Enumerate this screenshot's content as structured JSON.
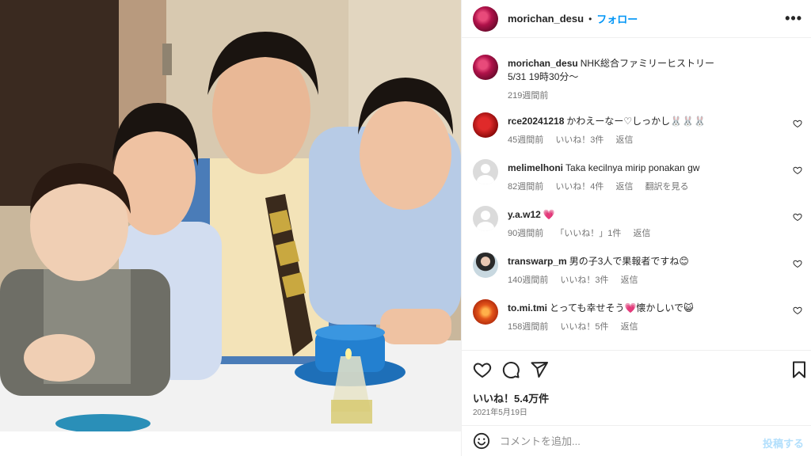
{
  "post": {
    "author": "morichan_desu",
    "follow_label": "フォロー",
    "separator": "•",
    "more_icon": "more-horizontal-icon",
    "photo_alt": "Family photo"
  },
  "caption": {
    "user": "morichan_desu",
    "text_line1": "NHK総合ファミリーヒストリー",
    "text_line2": "5/31 19時30分〜",
    "time": "219週間前"
  },
  "comments": [
    {
      "user": "rce20241218",
      "text": "かわえーなー♡しっかし🐰🐰🐰",
      "time": "45週間前",
      "likes": "いいね！3件",
      "reply": "返信",
      "translate": ""
    },
    {
      "user": "melimelhoni",
      "text": "Taka kecilnya mirip ponakan gw",
      "time": "82週間前",
      "likes": "いいね！4件",
      "reply": "返信",
      "translate": "翻訳を見る"
    },
    {
      "user": "y.a.w12",
      "text": "💗",
      "time": "90週間前",
      "likes": "「いいね！」1件",
      "reply": "返信",
      "translate": ""
    },
    {
      "user": "transwarp_m",
      "text": "男の子3人で果報者ですね😊",
      "time": "140週間前",
      "likes": "いいね！3件",
      "reply": "返信",
      "translate": ""
    },
    {
      "user": "to.mi.tmi",
      "text": "とっても幸せそう💗懐かしいで😺",
      "time": "158週間前",
      "likes": "いいね！5件",
      "reply": "返信",
      "translate": ""
    }
  ],
  "actions": {
    "likes": "いいね！5.4万件",
    "date": "2021年5月19日"
  },
  "add_comment": {
    "placeholder": "コメントを追加...",
    "post_label": "投稿する"
  },
  "colors": {
    "accent": "#0095f6",
    "post_disabled": "#b2dffc",
    "muted": "#737373"
  }
}
